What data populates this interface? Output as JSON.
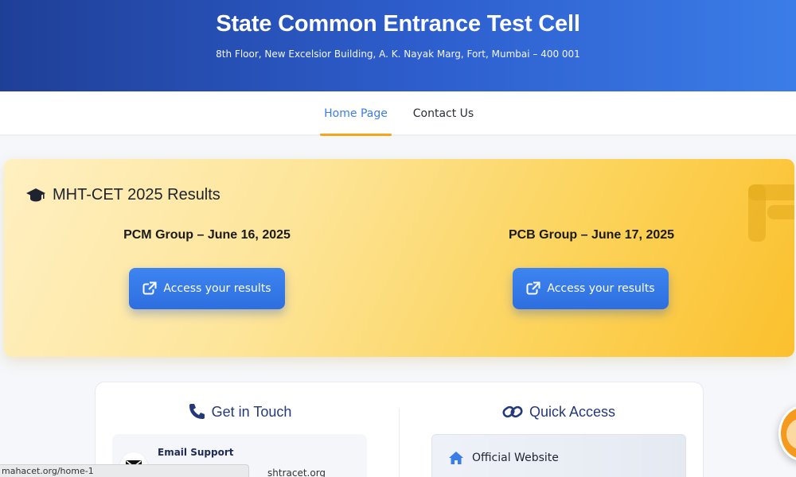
{
  "header": {
    "title": "State Common Entrance Test Cell",
    "address": "8th Floor, New Excelsior Building, A. K. Nayak Marg, Fort, Mumbai – 400 001"
  },
  "nav": {
    "items": [
      {
        "label": "Home Page",
        "active": true
      },
      {
        "label": "Contact Us",
        "active": false
      }
    ]
  },
  "results": {
    "heading": "MHT-CET 2025 Results",
    "icon": "graduation-cap-icon",
    "groups": [
      {
        "title": "PCM Group – June 16, 2025",
        "button_label": "Access your results"
      },
      {
        "title": "PCB Group – June 17, 2025",
        "button_label": "Access your results"
      }
    ]
  },
  "contact": {
    "get_in_touch": {
      "title": "Get in Touch",
      "icon": "phone-icon",
      "email_label": "Email Support",
      "email_value_visible": "shtracet.org"
    },
    "quick_access": {
      "title": "Quick Access",
      "icon": "link-icon",
      "items": [
        {
          "label": "Official Website",
          "icon": "home-icon"
        }
      ]
    }
  },
  "statusbar": {
    "url": "mahacet.org/home-1"
  },
  "colors": {
    "header_start": "#1f3f97",
    "header_end": "#3b7de8",
    "accent_blue": "#3b7de8",
    "nav_underline": "#f4a51c",
    "results_bg_end": "#fbc02d",
    "button_blue": "#2e6ee0"
  }
}
